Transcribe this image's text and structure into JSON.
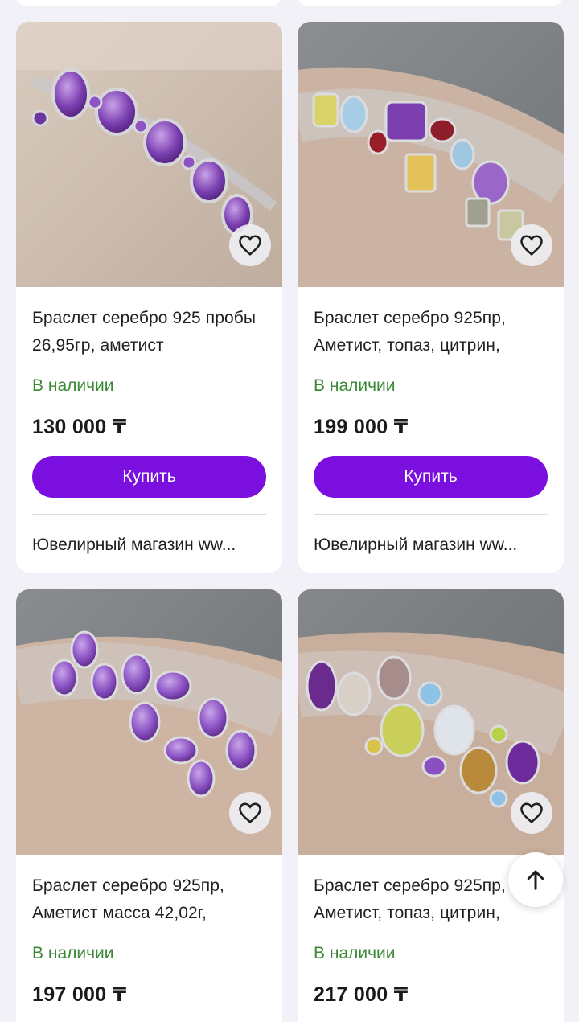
{
  "products": [
    {
      "title": "Браслет серебро 925 пробы 26,95гр, аметист",
      "stock": "В наличии",
      "price": "130 000 ₸",
      "buy_label": "Купить",
      "shop": "Ювелирный магазин ww..."
    },
    {
      "title": "Браслет серебро 925пр, Аметист, топаз, цитрин,",
      "stock": "В наличии",
      "price": "199 000 ₸",
      "buy_label": "Купить",
      "shop": "Ювелирный магазин ww..."
    },
    {
      "title": "Браслет серебро 925пр, Аметист масса 42,02г,",
      "stock": "В наличии",
      "price": "197 000 ₸"
    },
    {
      "title": "Браслет серебро 925пр, Аметист, топаз, цитрин,",
      "stock": "В наличии",
      "price": "217 000 ₸"
    }
  ],
  "icons": {
    "favorite": "heart-outline-icon",
    "scroll_top": "arrow-up-icon"
  },
  "colors": {
    "accent": "#7a0fe0",
    "in_stock": "#3a8a35",
    "background": "#f2f1f8"
  }
}
